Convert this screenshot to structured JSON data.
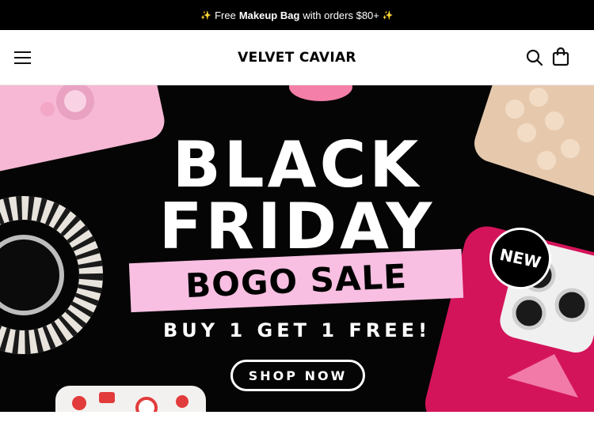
{
  "announcement": {
    "prefix": "Free",
    "highlight": "Makeup Bag",
    "suffix": "with orders $80+",
    "sparkle": "✨"
  },
  "header": {
    "brand": "VELVET CAVIAR",
    "menu_icon": "hamburger-menu-icon",
    "search_icon": "search-icon",
    "cart_icon": "shopping-bag-icon"
  },
  "hero": {
    "headline_line1": "BLACK",
    "headline_line2": "FRIDAY",
    "sale_label": "BOGO SALE",
    "subheadline": "BUY 1 GET 1 FREE!",
    "cta_label": "SHOP NOW",
    "badge": "NEW"
  },
  "colors": {
    "announcement_bg": "#000000",
    "hero_bg": "#050505",
    "sale_banner_pink": "#f8bfe2",
    "case_hot_pink": "#d4145a"
  }
}
